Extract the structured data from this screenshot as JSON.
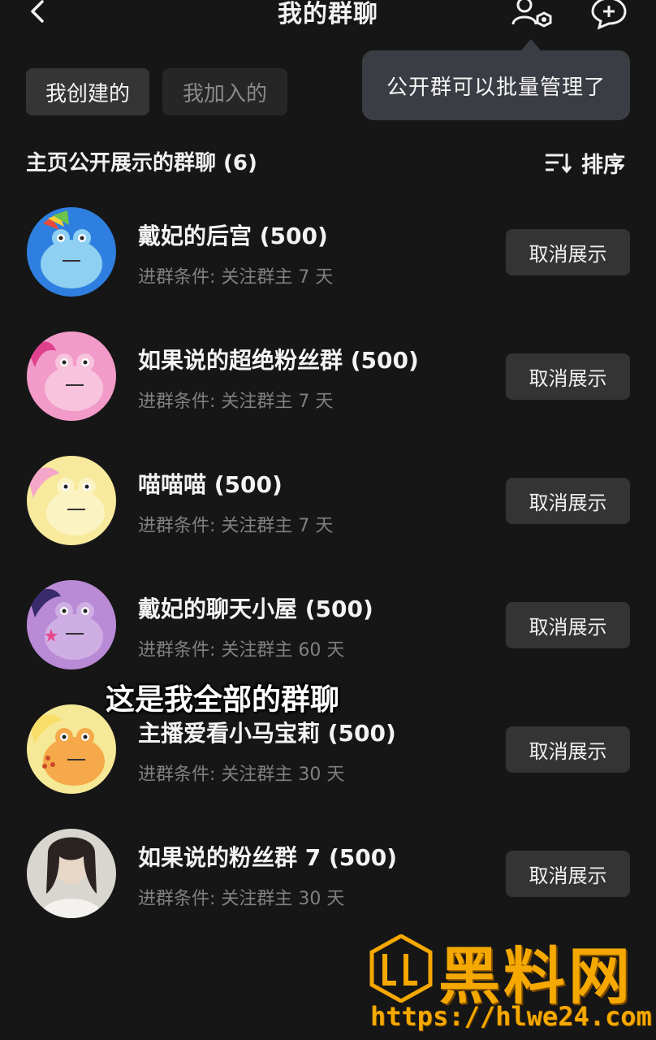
{
  "header": {
    "title": "我的群聊",
    "back_icon": "chevron-left-icon",
    "manage_icon": "group-settings-icon",
    "add_icon": "add-chat-icon"
  },
  "tabs": [
    {
      "label": "我创建的",
      "active": true
    },
    {
      "label": "我加入的",
      "active": false
    }
  ],
  "tooltip": {
    "text": "公开群可以批量管理了"
  },
  "section": {
    "title": "主页公开展示的群聊 (6)",
    "sort_label": "排序",
    "sort_icon": "sort-icon"
  },
  "groups": [
    {
      "name": "戴妃的后宫 (500)",
      "condition": "进群条件: 关注群主 7 天",
      "button": "取消展示",
      "avatar_color": "#2f7fe0"
    },
    {
      "name": "如果说的超绝粉丝群 (500)",
      "condition": "进群条件: 关注群主 7 天",
      "button": "取消展示",
      "avatar_color": "#f29ac8"
    },
    {
      "name": "喵喵喵 (500)",
      "condition": "进群条件: 关注群主 7 天",
      "button": "取消展示",
      "avatar_color": "#f7ea9c"
    },
    {
      "name": "戴妃的聊天小屋 (500)",
      "condition": "进群条件: 关注群主 60 天",
      "button": "取消展示",
      "avatar_color": "#b98ad6"
    },
    {
      "name": "主播爱看小马宝莉 (500)",
      "condition": "进群条件: 关注群主 30 天",
      "button": "取消展示",
      "avatar_color": "#f5a94a"
    },
    {
      "name": "如果说的粉丝群 7 (500)",
      "condition": "进群条件: 关注群主 30 天",
      "button": "取消展示",
      "avatar_color": "#d9d5cf"
    }
  ],
  "overlay_caption": "这是我全部的群聊",
  "watermark": {
    "brand": "黑料网",
    "url": "https://hlwe24.com",
    "color": "#f5a800"
  },
  "colors": {
    "background": "#161616",
    "button_bg": "#343434",
    "tooltip_bg": "#3b3d44",
    "muted_text": "#808080"
  }
}
